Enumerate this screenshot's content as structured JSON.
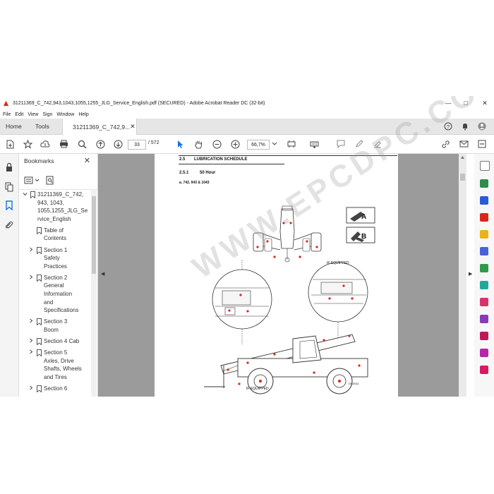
{
  "window": {
    "title": "31211369_C_742,943,1043,1055,1255_JLG_Service_English.pdf (SECURED) - Adobe Acrobat Reader DC (32-bit)"
  },
  "menu": [
    "File",
    "Edit",
    "View",
    "Sign",
    "Window",
    "Help"
  ],
  "tabs": {
    "home": "Home",
    "tools": "Tools",
    "doc": "31211369_C_742,9..."
  },
  "toolbar": {
    "page_current": "33",
    "page_total": "/ 572",
    "zoom": "66,7%"
  },
  "bookmarks": {
    "header": "Bookmarks",
    "items": [
      {
        "label_lines": [
          "31211369_C_742,",
          "943, 1043,",
          "1055,1255_JLG_Se",
          "rvice_English"
        ],
        "level": 0,
        "chevron": "v"
      },
      {
        "label_lines": [
          "Table of",
          "Contents"
        ],
        "level": 1,
        "chevron": ""
      },
      {
        "label_lines": [
          "Section 1",
          "Safety",
          "Practices"
        ],
        "level": 1,
        "chevron": ">"
      },
      {
        "label_lines": [
          "Section 2",
          "General",
          "Information",
          "and",
          "Specifications"
        ],
        "level": 1,
        "chevron": ">"
      },
      {
        "label_lines": [
          "Section 3",
          "Boom"
        ],
        "level": 1,
        "chevron": ">"
      },
      {
        "label_lines": [
          "Section 4 Cab"
        ],
        "level": 1,
        "chevron": ">"
      },
      {
        "label_lines": [
          "Section 5",
          "Axles, Drive",
          "Shafts, Wheels",
          "and Tires"
        ],
        "level": 1,
        "chevron": ">"
      },
      {
        "label_lines": [
          "Section 6"
        ],
        "level": 1,
        "chevron": ">"
      }
    ]
  },
  "document": {
    "section_num": "2.5",
    "section_title": "LUBRICATION SCHEDULE",
    "subsection_num": "2.5.1",
    "subsection_title": "50 Hour",
    "item": "a.   742, 943 & 1043",
    "label_a": "A",
    "label_b": "B",
    "if_equipped_1": "IF EQUIPPED",
    "if_equipped_2": "IF EQUIPPED",
    "figure_code": "OC0011",
    "watermark": "WWW.EPCDPC.COM"
  },
  "colors": {
    "accent": "#1473e6",
    "tab_bg": "#e6e6e6",
    "doc_bg": "#9b9b9b",
    "pdf_red": "#d9261c"
  }
}
